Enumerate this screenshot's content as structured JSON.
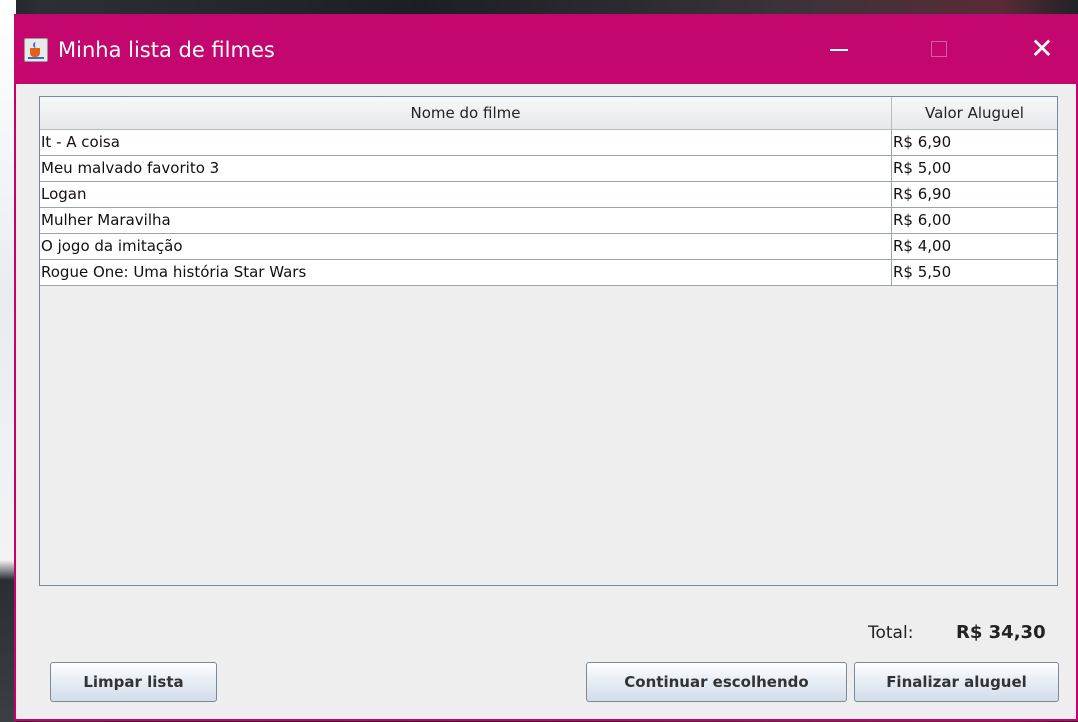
{
  "window": {
    "title": "Minha lista de filmes",
    "icon": "java-cup-icon",
    "controls": {
      "minimize": "minimize-icon",
      "maximize": "maximize-icon",
      "close": "close-icon"
    },
    "accent_color": "#c4066f"
  },
  "table": {
    "headers": {
      "name": "Nome do filme",
      "price": "Valor Aluguel"
    },
    "rows": [
      {
        "name": "It - A coisa",
        "price": "R$ 6,90"
      },
      {
        "name": "Meu malvado favorito 3",
        "price": "R$ 5,00"
      },
      {
        "name": "Logan",
        "price": "R$ 6,90"
      },
      {
        "name": "Mulher Maravilha",
        "price": "R$ 6,00"
      },
      {
        "name": "O jogo da imitação",
        "price": "R$ 4,00"
      },
      {
        "name": "Rogue One: Uma história Star Wars",
        "price": "R$ 5,50"
      }
    ]
  },
  "total": {
    "label": "Total:",
    "value": "R$ 34,30"
  },
  "buttons": {
    "clear": "Limpar lista",
    "continue": "Continuar escolhendo",
    "finish": "Finalizar aluguel"
  }
}
